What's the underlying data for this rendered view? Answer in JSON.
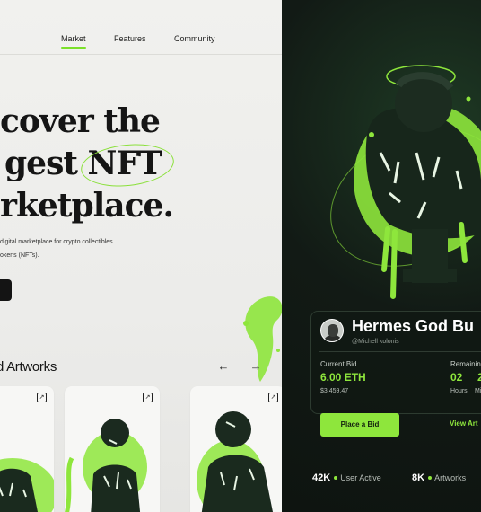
{
  "nav": {
    "items": [
      {
        "label": "Market",
        "active": true
      },
      {
        "label": "Features",
        "active": false
      },
      {
        "label": "Community",
        "active": false
      }
    ]
  },
  "hero": {
    "line1": "cover the",
    "line2_prefix": "gest",
    "line2_highlight": "NFT",
    "line3": "rketplace.",
    "sub1": "digital marketplace for crypto collectibles",
    "sub2": "okens (NFTs)."
  },
  "featured": {
    "title": "d Artworks",
    "prev_icon": "arrow-left-icon",
    "next_icon": "arrow-right-icon",
    "card_link_icon": "external-link-icon"
  },
  "detail": {
    "title": "Hermes God Bu",
    "handle": "@Michell kolonis",
    "current_bid_label": "Current Bid",
    "current_bid": "6.00 ETH",
    "current_bid_usd": "$3,459.47",
    "remaining_label": "Remainin",
    "timer_hours": "02",
    "timer_minutes": "2",
    "hours_label": "Hours",
    "minutes_label": "Mi"
  },
  "actions": {
    "place_bid": "Place a Bid",
    "view_art": "View Art"
  },
  "stats": [
    {
      "value": "42K",
      "label": "User Active"
    },
    {
      "value": "8K",
      "label": "Artworks"
    }
  ],
  "colors": {
    "accent": "#8ee63c",
    "dark_bg": "#121a15",
    "light_bg": "#efefec"
  }
}
